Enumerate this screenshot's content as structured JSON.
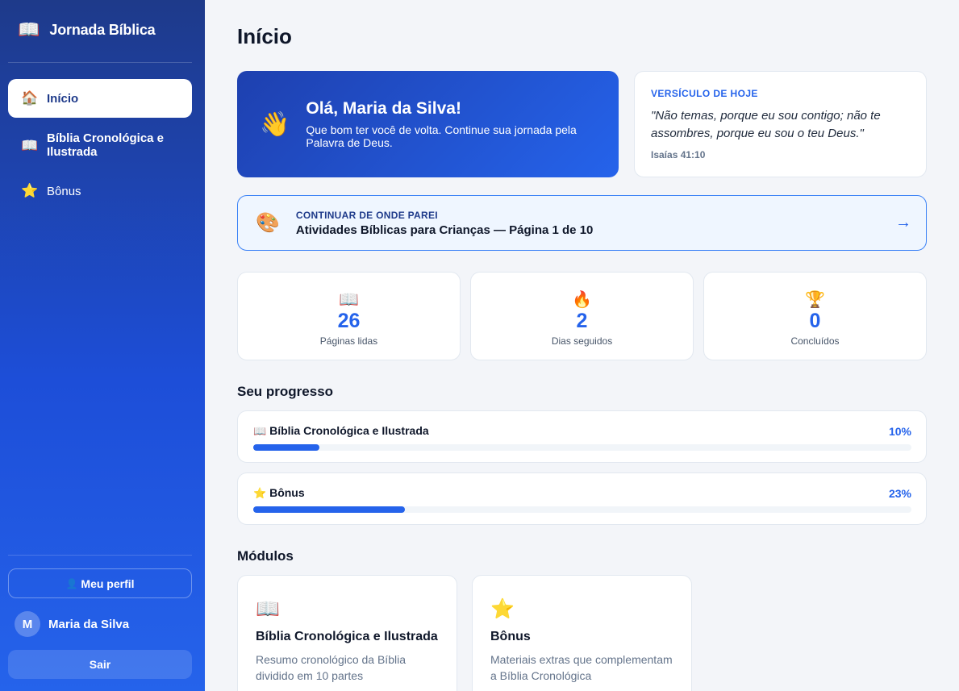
{
  "app": {
    "name": "Jornada Bíblica",
    "icon": "open-book-icon"
  },
  "sidebar": {
    "items": [
      {
        "label": "Início",
        "icon": "house-icon"
      },
      {
        "label": "Bíblia Cronológica e Ilustrada",
        "icon": "open-book-icon"
      },
      {
        "label": "Bônus",
        "icon": "star-icon"
      }
    ],
    "profile_button": "Meu perfil",
    "user_name": "Maria da Silva",
    "user_initial": "M",
    "logout_label": "Sair"
  },
  "main": {
    "title": "Início",
    "welcome": {
      "greeting": "Olá, Maria da Silva!",
      "message": "Que bom ter você de volta. Continue sua jornada pela Palavra de Deus.",
      "icon": "waving-hand-icon"
    },
    "verse": {
      "label": "VERSÍCULO DE HOJE",
      "text": "\"Não temas, porque eu sou contigo; não te assombres, porque eu sou o teu Deus.\"",
      "reference": "Isaías 41:10"
    },
    "continue": {
      "label": "CONTINUAR DE ONDE PAREI",
      "title": "Atividades Bíblicas para Crianças — Página 1 de 10",
      "arrow": "→",
      "icon": "palette-icon"
    },
    "stats": [
      {
        "value": "26",
        "label": "Páginas lidas",
        "icon": "open-book-icon"
      },
      {
        "value": "2",
        "label": "Dias seguidos",
        "icon": "fire-icon"
      },
      {
        "value": "0",
        "label": "Concluídos",
        "icon": "trophy-icon"
      }
    ],
    "progress_title": "Seu progresso",
    "progress": [
      {
        "name": "Bíblia Cronológica e Ilustrada",
        "percent_label": "10%",
        "fraction": 0.1,
        "icon": "open-book-icon"
      },
      {
        "name": "Bônus",
        "percent_label": "23%",
        "fraction": 0.23,
        "icon": "star-icon"
      }
    ],
    "modules_title": "Módulos",
    "modules": [
      {
        "title": "Bíblia Cronológica e Ilustrada",
        "description": "Resumo cronológico da Bíblia dividido em 10 partes",
        "icon": "open-book-icon"
      },
      {
        "title": "Bônus",
        "description": "Materiais extras que complementam a Bíblia Cronológica",
        "icon": "star-icon"
      }
    ]
  },
  "colors": {
    "accent": "#2563eb",
    "sidebar_top": "#1e3a8a",
    "sidebar_bottom": "#2563eb"
  }
}
